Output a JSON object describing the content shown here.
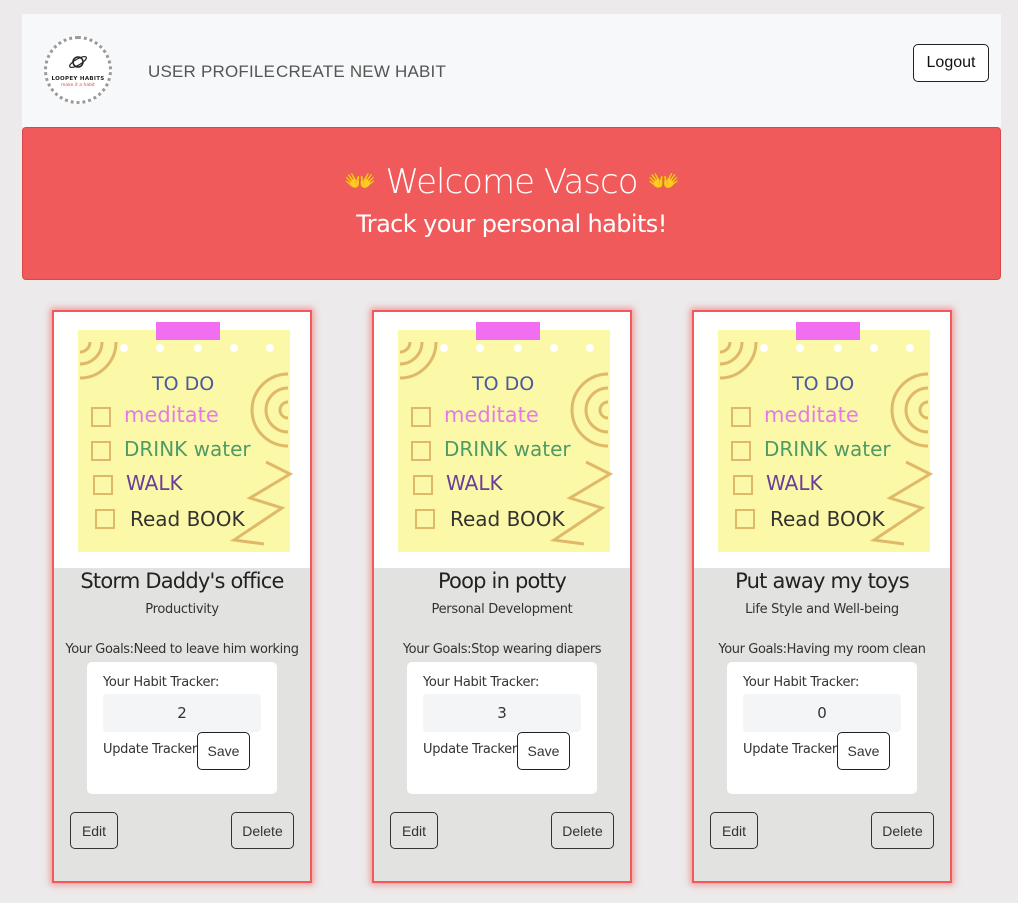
{
  "nav": {
    "logo_title": "LOOPEY HABITS",
    "logo_slogan": "make it a habit",
    "links": [
      "USER PROFILE",
      "CREATE NEW HABIT"
    ],
    "logout_label": "Logout"
  },
  "hero": {
    "hand_icon": "👐",
    "welcome": "Welcome Vasco",
    "subtitle": "Track your personal habits!"
  },
  "note": {
    "heading": "TO DO",
    "items": [
      "meditate",
      "DRINK water",
      "WALK",
      "Read BOOK"
    ]
  },
  "colors": {
    "accent": "#f05a5b",
    "note_yellow": "#fbf9a7",
    "tape_pink": "#f26ef0",
    "card_bg": "#e2e2e1"
  },
  "cards": [
    {
      "title": "Storm Daddy's office",
      "category": "Productivity",
      "goals": "Your Goals:Need to leave him working",
      "tracker_label": "Your Habit Tracker:",
      "tracker_value": "2",
      "update_label": "Update Tracker:",
      "save_label": "Save",
      "edit_label": "Edit",
      "delete_label": "Delete"
    },
    {
      "title": "Poop in potty",
      "category": "Personal Development",
      "goals": "Your Goals:Stop wearing diapers",
      "tracker_label": "Your Habit Tracker:",
      "tracker_value": "3",
      "update_label": "Update Tracker:",
      "save_label": "Save",
      "edit_label": "Edit",
      "delete_label": "Delete"
    },
    {
      "title": "Put away my toys",
      "category": "Life Style and Well-being",
      "goals": "Your Goals:Having my room clean",
      "tracker_label": "Your Habit Tracker:",
      "tracker_value": "0",
      "update_label": "Update Tracker:",
      "save_label": "Save",
      "edit_label": "Edit",
      "delete_label": "Delete"
    }
  ]
}
